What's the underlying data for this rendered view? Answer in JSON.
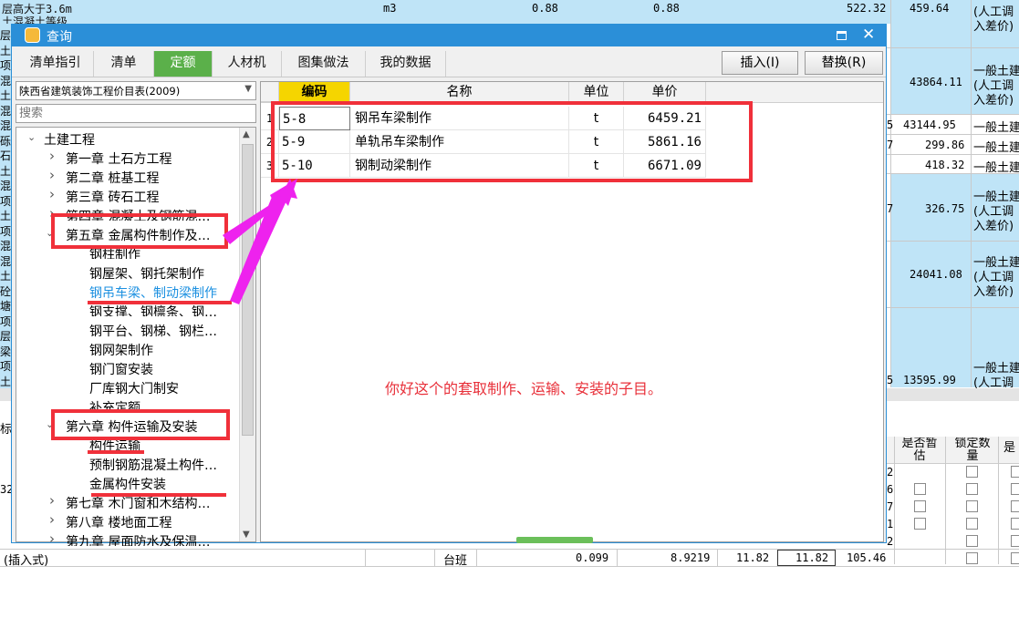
{
  "background": {
    "top_rows": [
      {
        "text_line1": "层高大于3.6m",
        "text_line2": "土混凝土等级",
        "unit": "m3",
        "qty1": "0.88",
        "qty2": "0.88",
        "price": "522.32",
        "total": "459.64",
        "note1": "(人工调",
        "note2": "入差价)"
      },
      {
        "total": "43864.11",
        "note1": "一般土建",
        "note2": "(人工调",
        "note3": "入差价)"
      },
      {
        "total": "43144.95",
        "note1": "一般土建"
      },
      {
        "total": "299.86",
        "note1": "一般土建"
      },
      {
        "total": "418.32",
        "note1": "一般土建"
      },
      {
        "total": "326.75",
        "note1": "一般土建",
        "note2": "(人工调",
        "note3": "入差价)"
      },
      {
        "total": "24041.08",
        "note1": "一般土建",
        "note2": "(人工调",
        "note3": "入差价)"
      },
      {
        "total": "13595.99",
        "note1": "一般土建",
        "note2": "(人工调"
      }
    ],
    "left_fragments": [
      "层高",
      "土混凝",
      "项目",
      "混凝",
      "土混",
      "混凝",
      "混",
      "砾",
      "石层",
      "土",
      "混凝",
      "项目",
      "土混",
      "项目",
      "混凝",
      "混凝",
      "土混",
      "砼垫",
      "塘",
      "项目",
      "层高",
      "梁",
      "项目",
      "土混"
    ],
    "right_side_codes": [
      "5",
      "7",
      "7",
      "5"
    ],
    "bottom_headers": {
      "estimate": "是否暂估",
      "lock_qty": "锁定数量",
      "fixed": "是"
    },
    "bottom_left_fragments": [
      "标准",
      "32"
    ],
    "bottom_side_nums": [
      "2",
      "6",
      "7",
      "1",
      "2"
    ],
    "bottom_row": {
      "label": "(插入式)",
      "unit": "台班",
      "qty": "0.099",
      "price": "8.9219",
      "v1": "11.82",
      "v2": "11.82",
      "total": "105.46"
    }
  },
  "dialog": {
    "title": "查询",
    "tabs": [
      {
        "label": "清单指引"
      },
      {
        "label": "清单"
      },
      {
        "label": "定额"
      },
      {
        "label": "人材机"
      },
      {
        "label": "图集做法"
      },
      {
        "label": "我的数据"
      }
    ],
    "insert_button": "插入(I)",
    "replace_button": "替换(R)",
    "library_select": "陕西省建筑装饰工程价目表(2009)",
    "search_placeholder": "搜索",
    "tree": [
      {
        "label": "土建工程"
      },
      {
        "label": "第一章 土石方工程"
      },
      {
        "label": "第二章 桩基工程"
      },
      {
        "label": "第三章 砖石工程"
      },
      {
        "label": "第四章 混凝土及钢筋混…"
      },
      {
        "label": "第五章 金属构件制作及…"
      },
      {
        "label": "钢柱制作"
      },
      {
        "label": "钢屋架、钢托架制作"
      },
      {
        "label": "钢吊车梁、制动梁制作"
      },
      {
        "label": "钢支撑、钢檩条、钢…"
      },
      {
        "label": "钢平台、钢梯、钢栏…"
      },
      {
        "label": "钢网架制作"
      },
      {
        "label": "钢门窗安装"
      },
      {
        "label": "厂库钢大门制安"
      },
      {
        "label": "补充定额"
      },
      {
        "label": "第六章 构件运输及安装"
      },
      {
        "label": "构件运输"
      },
      {
        "label": "预制钢筋混凝土构件…"
      },
      {
        "label": "金属构件安装"
      },
      {
        "label": "第七章 木门窗和木结构…"
      },
      {
        "label": "第八章 楼地面工程"
      },
      {
        "label": "第九章 屋面防水及保温…"
      }
    ],
    "table": {
      "headers": {
        "code": "编码",
        "name": "名称",
        "unit": "单位",
        "price": "单价"
      },
      "rows": [
        {
          "idx": "1",
          "code": "5-8",
          "name": "钢吊车梁制作",
          "unit": "t",
          "price": "6459.21"
        },
        {
          "idx": "2",
          "code": "5-9",
          "name": "单轨吊车梁制作",
          "unit": "t",
          "price": "5861.16"
        },
        {
          "idx": "3",
          "code": "5-10",
          "name": "钢制动梁制作",
          "unit": "t",
          "price": "6671.09"
        }
      ]
    },
    "annotation": "你好这个的套取制作、运输、安装的子目。"
  },
  "colors": {
    "title_blue": "#2b8fd8",
    "tab_active_green": "#5bb04a",
    "highlight_red": "#f0303a",
    "arrow_magenta": "#ee22ee",
    "selected_blue": "#1a8fe0",
    "row_blue": "#bfe4f7"
  }
}
